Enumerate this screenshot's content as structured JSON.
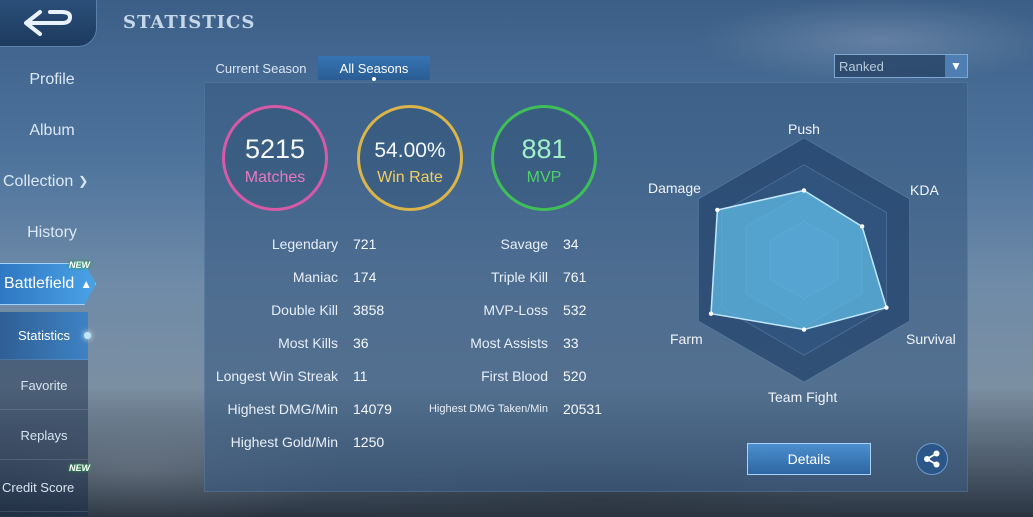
{
  "header": {
    "title": "STATISTICS"
  },
  "sidebar": {
    "items": [
      {
        "label": "Profile"
      },
      {
        "label": "Album"
      },
      {
        "label": "Collection"
      },
      {
        "label": "History"
      },
      {
        "label": "Battlefield"
      }
    ],
    "new_badge": "NEW",
    "sub_items": [
      {
        "label": "Statistics"
      },
      {
        "label": "Favorite"
      },
      {
        "label": "Replays"
      },
      {
        "label": "Credit Score"
      }
    ]
  },
  "tabs": [
    {
      "label": "Current Season"
    },
    {
      "label": "All Seasons"
    }
  ],
  "mode_select": {
    "value": "Ranked"
  },
  "summary": {
    "matches": {
      "value": "5215",
      "label": "Matches",
      "color": "#d65aa6"
    },
    "win_rate": {
      "value": "54.00%",
      "label": "Win Rate",
      "color": "#d9b54a"
    },
    "mvp": {
      "value": "881",
      "label": "MVP",
      "color": "#3fbf58"
    }
  },
  "stats_left": [
    {
      "label": "Legendary",
      "value": "721"
    },
    {
      "label": "Maniac",
      "value": "174"
    },
    {
      "label": "Double Kill",
      "value": "3858"
    },
    {
      "label": "Most Kills",
      "value": "36"
    },
    {
      "label": "Longest Win Streak",
      "value": "11"
    },
    {
      "label": "Highest DMG/Min",
      "value": "14079"
    },
    {
      "label": "Highest Gold/Min",
      "value": "1250"
    }
  ],
  "stats_right": [
    {
      "label": "Savage",
      "value": "34"
    },
    {
      "label": "Triple Kill",
      "value": "761"
    },
    {
      "label": "MVP-Loss",
      "value": "532"
    },
    {
      "label": "Most Assists",
      "value": "33"
    },
    {
      "label": "First Blood",
      "value": "520"
    },
    {
      "label": "Highest DMG Taken/Min",
      "value": "20531"
    }
  ],
  "radar": {
    "axes": [
      "Push",
      "KDA",
      "Survival",
      "Team Fight",
      "Farm",
      "Damage"
    ],
    "values": [
      0.57,
      0.55,
      0.78,
      0.57,
      0.88,
      0.82
    ]
  },
  "actions": {
    "details_label": "Details"
  }
}
